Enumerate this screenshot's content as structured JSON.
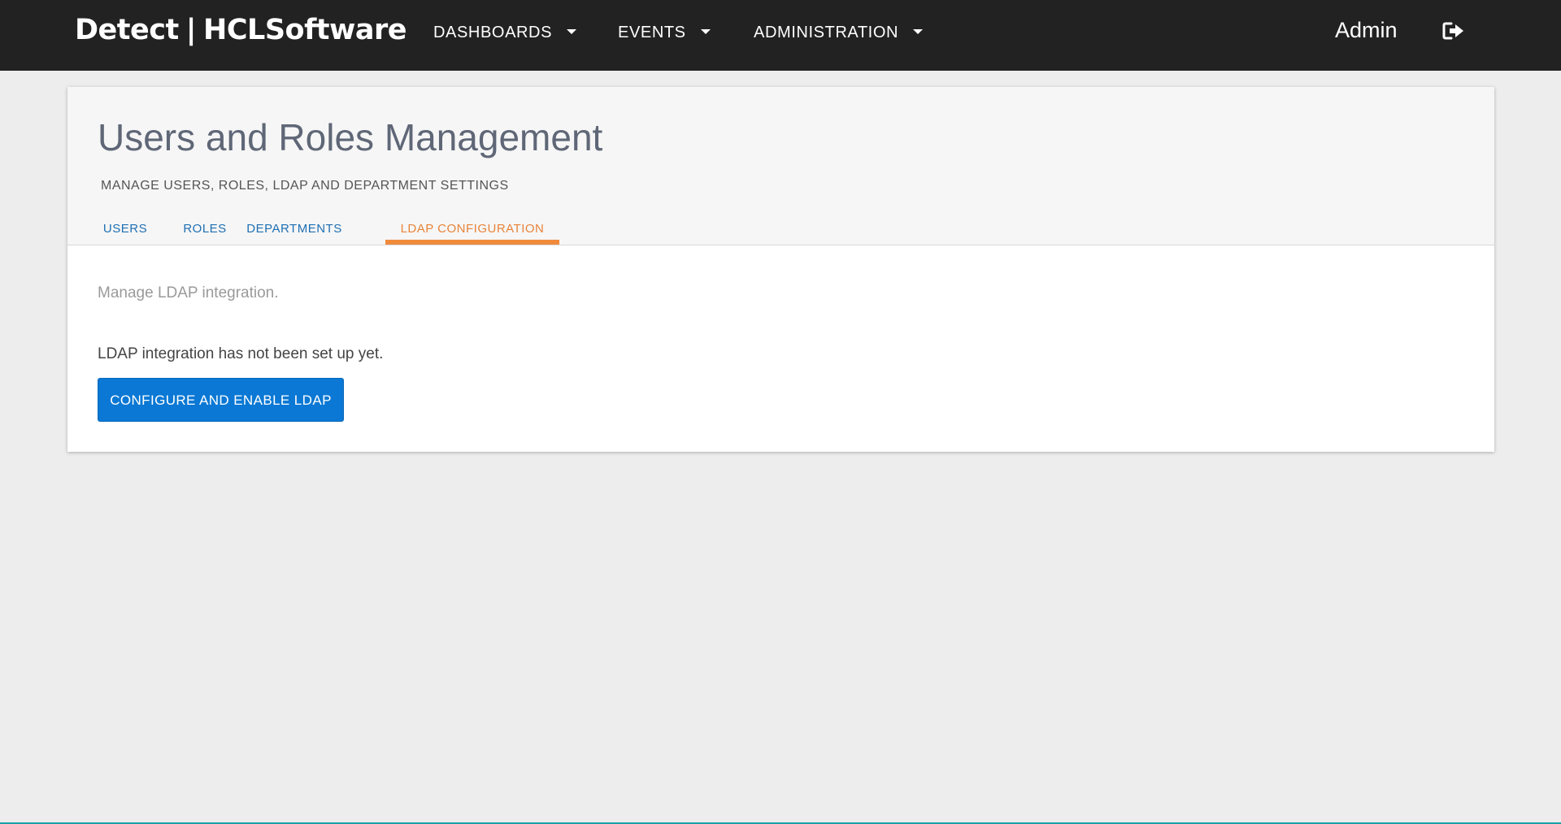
{
  "header": {
    "brand_product": "Detect",
    "brand_separator": "|",
    "brand_company": "HCLSoftware",
    "nav": [
      {
        "label": "DASHBOARDS"
      },
      {
        "label": "EVENTS"
      },
      {
        "label": "ADMINISTRATION"
      }
    ],
    "user_label": "Admin",
    "logout_icon": "logout-icon"
  },
  "page": {
    "title": "Users and Roles Management",
    "subtitle": "MANAGE USERS, ROLES, LDAP AND DEPARTMENT SETTINGS",
    "tabs": [
      {
        "label": "USERS"
      },
      {
        "label": "ROLES"
      },
      {
        "label": "DEPARTMENTS"
      },
      {
        "label": "LDAP CONFIGURATION",
        "active": true
      }
    ]
  },
  "ldap": {
    "description": "Manage LDAP integration.",
    "status": "LDAP integration has not been set up yet.",
    "button_label": "CONFIGURE AND ENABLE LDAP"
  },
  "colors": {
    "topbar": "#222222",
    "background": "#ededed",
    "tab_link": "#1f6fb2",
    "tab_active": "#f08a3c",
    "primary_button": "#0a78d4"
  }
}
